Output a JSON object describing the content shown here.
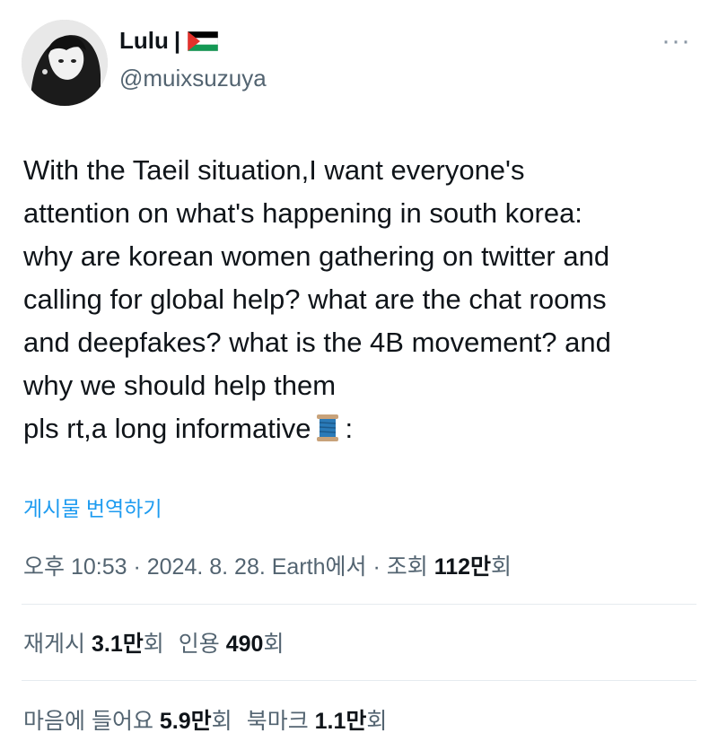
{
  "user": {
    "display_name": "Lulu",
    "separator": "|",
    "flag": "palestine-flag",
    "handle": "@muixsuzuya"
  },
  "tweet": {
    "text": "With the Taeil situation,I want everyone's\nattention on what's happening in south korea:\nwhy are korean women gathering on twitter and\ncalling for global help? what are the chat rooms\nand deepfakes? what is the 4B movement? and\nwhy we should help them\npls rt,a long informative",
    "emoji": "spool-of-thread",
    "text_end": ":",
    "translate_label": "게시물 번역하기"
  },
  "meta": {
    "time": "오후 10:53",
    "dot1": " · ",
    "date": "2024. 8. 28.",
    "source": "Earth에서",
    "dot2": " · ",
    "views_label": "조회",
    "views_value": "112만",
    "views_suffix": "회"
  },
  "stats": {
    "retweets_label": "재게시",
    "retweets_value": "3.1만",
    "retweets_suffix": "회",
    "quotes_label": "인용",
    "quotes_value": "490",
    "quotes_suffix": "회",
    "likes_label": "마음에 들어요",
    "likes_value": "5.9만",
    "likes_suffix": "회",
    "bookmarks_label": "북마크",
    "bookmarks_value": "1.1만",
    "bookmarks_suffix": "회"
  },
  "icons": {
    "more": "more-horizontal-icon"
  },
  "colors": {
    "link": "#1d9bf0",
    "secondary_text": "#536471",
    "primary_text": "#0f1419",
    "divider": "#e6ebef"
  }
}
